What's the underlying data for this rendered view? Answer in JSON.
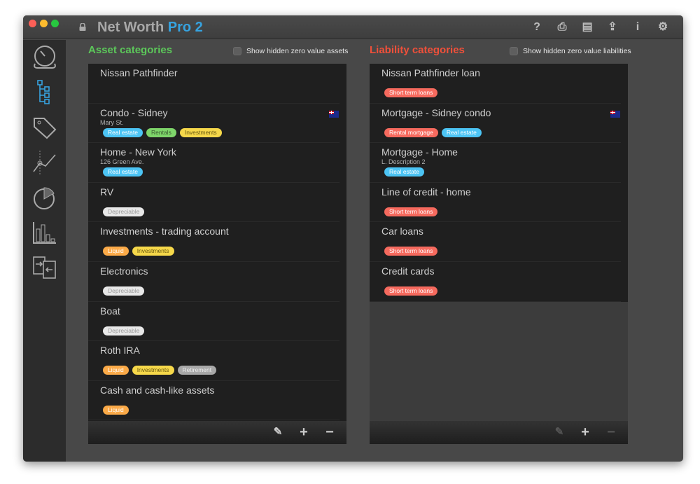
{
  "window": {
    "title_main": "Net Worth",
    "title_accent": "Pro 2"
  },
  "toolbar": {
    "icons": [
      "help-icon",
      "print-icon",
      "document-icon",
      "share-icon",
      "info-icon",
      "gear-icon"
    ],
    "glyphs": [
      "?",
      "⎙",
      "▤",
      "⇪",
      "i",
      "⚙"
    ]
  },
  "sidebar": {
    "items": [
      "dashboard-icon",
      "categories-icon",
      "tags-icon",
      "trend-chart-icon",
      "pie-chart-icon",
      "bar-chart-icon",
      "transfer-icon"
    ],
    "active": "categories-icon",
    "accent": "#36a3e0"
  },
  "assets": {
    "title": "Asset categories",
    "title_color": "#5cc85a",
    "show_hidden_label": "Show hidden zero value assets",
    "show_hidden_checked": false,
    "items": [
      {
        "name": "Nissan Pathfinder",
        "sub": "",
        "tags": [],
        "flag": false
      },
      {
        "name": "Condo - Sidney",
        "sub": "Mary St.",
        "tags": [
          "Real estate",
          "Rentals",
          "Investments"
        ],
        "flag": true
      },
      {
        "name": "Home - New York",
        "sub": "126 Green Ave.",
        "tags": [
          "Real estate"
        ],
        "flag": false
      },
      {
        "name": "RV",
        "sub": "",
        "tags": [
          "Depreciable"
        ],
        "flag": false
      },
      {
        "name": "Investments - trading account",
        "sub": "",
        "tags": [
          "Liquid",
          "Investments"
        ],
        "flag": false
      },
      {
        "name": "Electronics",
        "sub": "",
        "tags": [
          "Depreciable"
        ],
        "flag": false
      },
      {
        "name": "Boat",
        "sub": "",
        "tags": [
          "Depreciable"
        ],
        "flag": false
      },
      {
        "name": "Roth IRA",
        "sub": "",
        "tags": [
          "Liquid",
          "Investments",
          "Retirement"
        ],
        "flag": false
      },
      {
        "name": "Cash and cash-like assets",
        "sub": "",
        "tags": [
          "Liquid"
        ],
        "flag": false
      }
    ]
  },
  "liabilities": {
    "title": "Liability categories",
    "title_color": "#f0503a",
    "show_hidden_label": "Show hidden zero value liabilities",
    "show_hidden_checked": false,
    "items": [
      {
        "name": "Nissan Pathfinder loan",
        "sub": "",
        "tags": [
          "Short term loans"
        ],
        "flag": false
      },
      {
        "name": "Mortgage - Sidney condo",
        "sub": "",
        "tags": [
          "Rental mortgage",
          "Real estate"
        ],
        "flag": true
      },
      {
        "name": "Mortgage - Home",
        "sub": "L. Description 2",
        "tags": [
          "Real estate"
        ],
        "flag": false
      },
      {
        "name": "Line of credit - home",
        "sub": "",
        "tags": [
          "Short term loans"
        ],
        "flag": false
      },
      {
        "name": "Car loans",
        "sub": "",
        "tags": [
          "Short term loans"
        ],
        "flag": false
      },
      {
        "name": "Credit cards",
        "sub": "",
        "tags": [
          "Short term loans"
        ],
        "flag": false
      }
    ]
  },
  "tag_colors": {
    "Real estate": [
      "#4cc4f4",
      "#fff"
    ],
    "Rentals": [
      "#7ed56a",
      "#3a5a30"
    ],
    "Investments": [
      "#f6d84a",
      "#6a5a10"
    ],
    "Depreciable": [
      "#e8e8e8",
      "#999"
    ],
    "Liquid": [
      "#fbaa48",
      "#fff"
    ],
    "Retirement": [
      "#a8a8a8",
      "#f0f0f0"
    ],
    "Short term loans": [
      "#f66a5e",
      "#fff"
    ],
    "Rental mortgage": [
      "#f66a5e",
      "#fff"
    ]
  },
  "footer": {
    "asset_buttons": [
      "edit-icon",
      "plus-icon",
      "minus-icon"
    ],
    "liability_edit_enabled": false,
    "liability_minus_enabled": false
  }
}
